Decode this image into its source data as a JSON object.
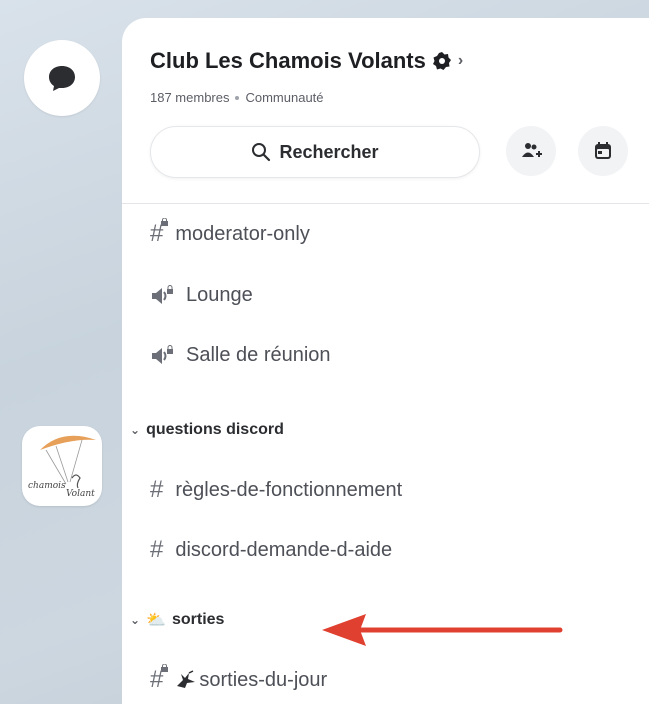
{
  "server": {
    "name": "Club Les Chamois Volants",
    "members": "187 membres",
    "type": "Communauté"
  },
  "search": {
    "label": "Rechercher"
  },
  "channels": [
    {
      "kind": "text-locked",
      "name": "moderator-only"
    },
    {
      "kind": "voice-locked",
      "name": "Lounge"
    },
    {
      "kind": "voice-locked",
      "name": "Salle de réunion"
    }
  ],
  "categories": [
    {
      "name": "questions discord",
      "channels": [
        {
          "kind": "text",
          "name": "règles-de-fonctionnement"
        },
        {
          "kind": "text",
          "name": "discord-demande-d-aide"
        }
      ]
    },
    {
      "name": "sorties",
      "emoji": "⛅",
      "channels": [
        {
          "kind": "text-locked",
          "name": "sorties-du-jour"
        }
      ]
    }
  ],
  "server_logo_text": "Chamois Volants",
  "colors": {
    "arrow": "#e0402f",
    "accent": "#1e1f22"
  }
}
